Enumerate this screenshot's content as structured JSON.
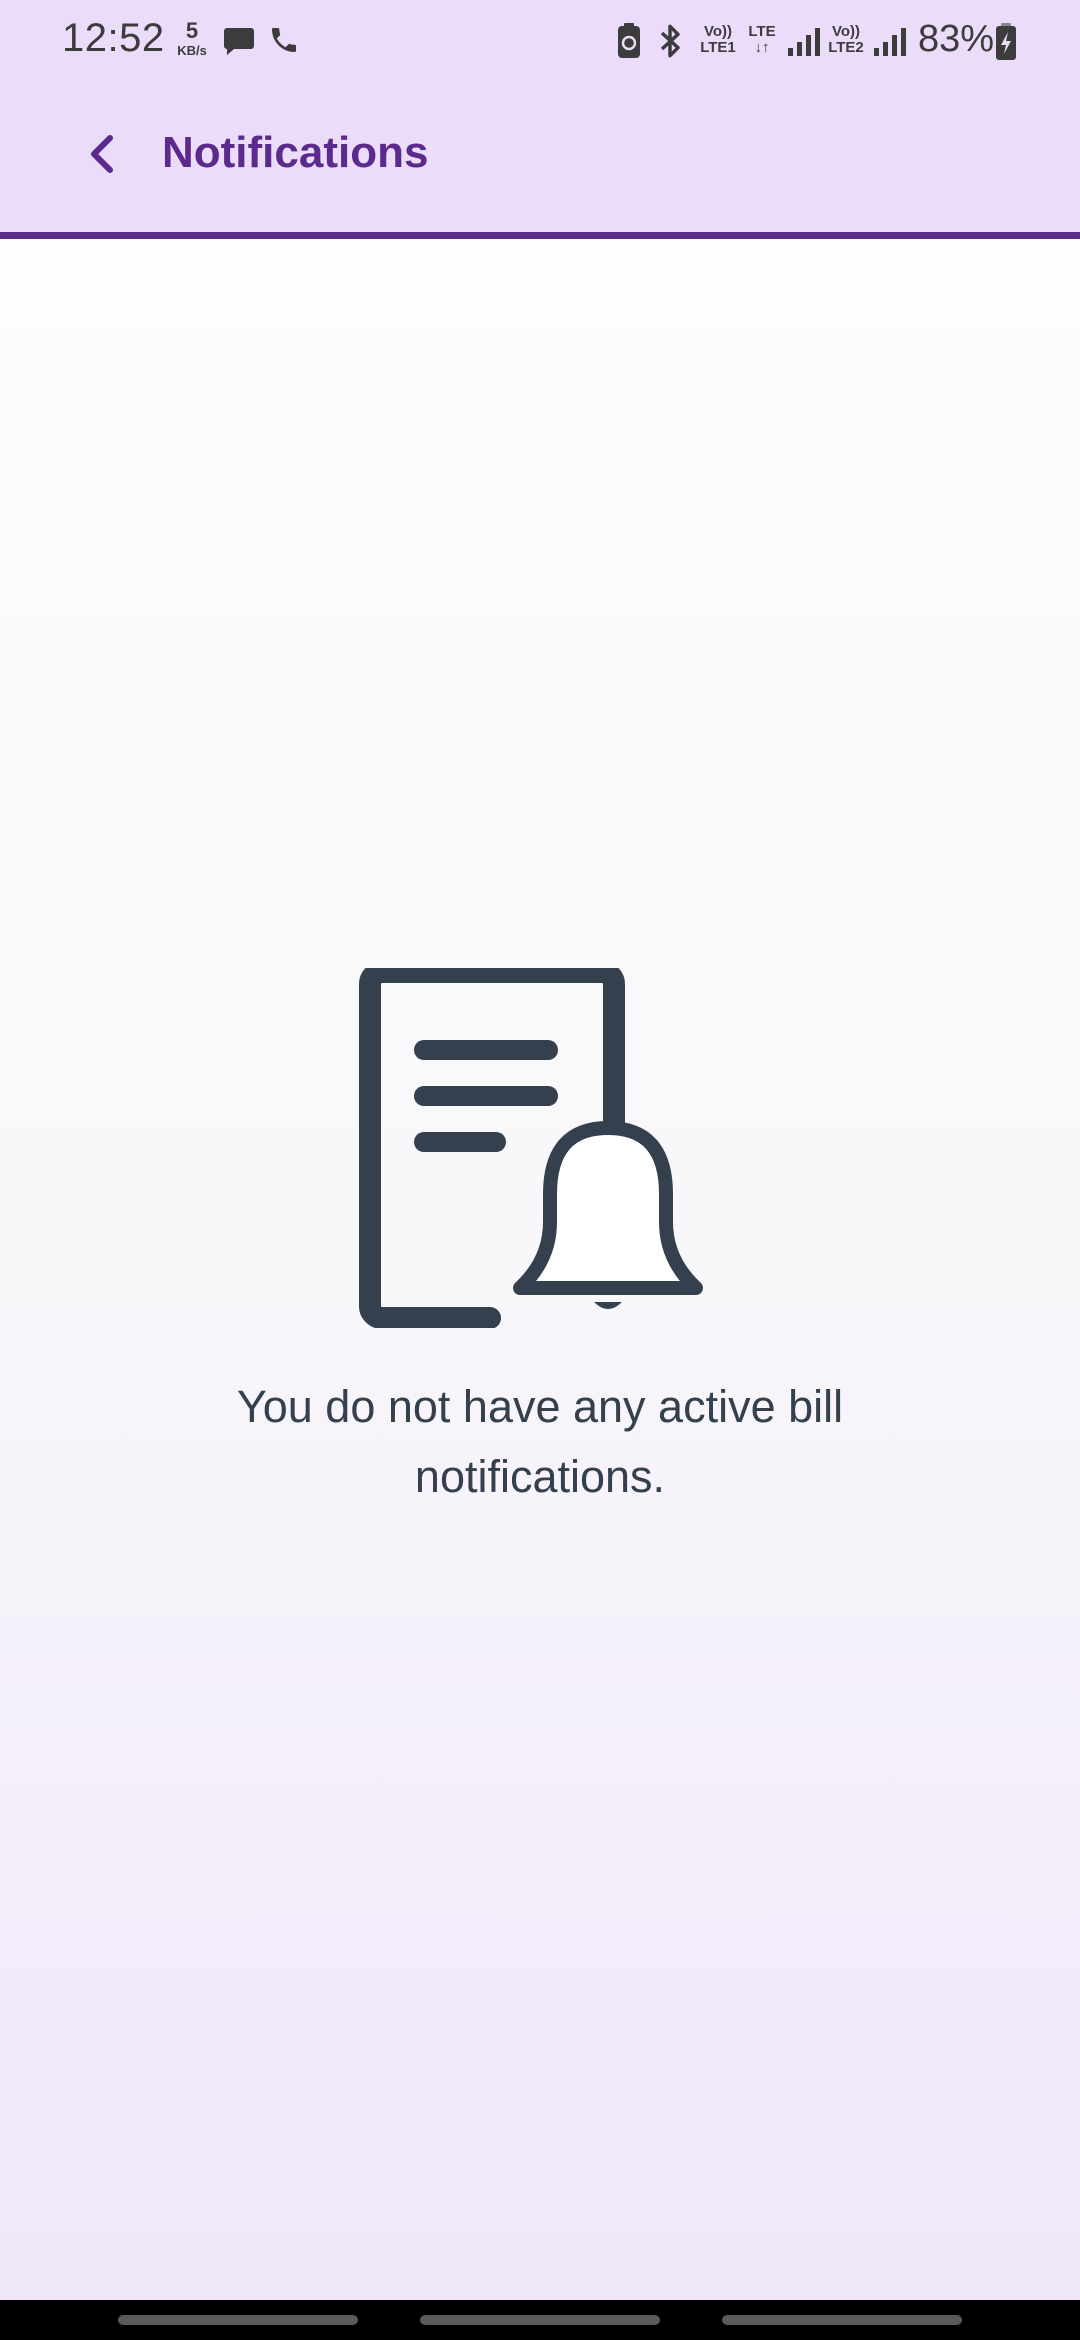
{
  "status_bar": {
    "time": "12:52",
    "net_speed_value": "5",
    "net_speed_unit": "KB/s",
    "sim1_label_top": "Vo))",
    "sim1_label_bottom": "LTE1",
    "data_label_top": "LTE",
    "data_label_bottom": "↓↑",
    "sim2_label_top": "Vo))",
    "sim2_label_bottom": "LTE2",
    "battery_percent": "83%",
    "icons": [
      "message-icon",
      "phone-icon",
      "battery-saver-icon",
      "bluetooth-icon",
      "signal-icon",
      "battery-charging-icon"
    ]
  },
  "app_bar": {
    "title": "Notifications",
    "back_icon": "chevron-left-icon",
    "accent_color": "#5b2a8c",
    "background_color": "#ebdcfa"
  },
  "empty_state": {
    "illustration_icon": "bill-notification-icon",
    "message": "You do not have any active bill notifications."
  }
}
